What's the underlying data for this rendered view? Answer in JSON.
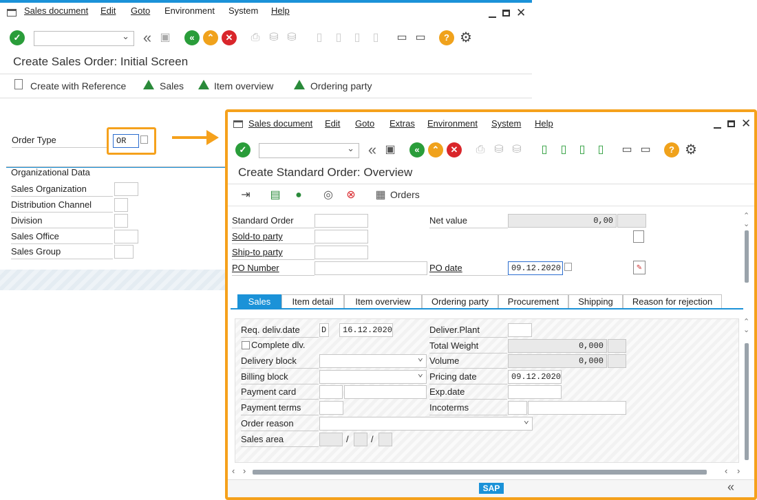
{
  "back_window": {
    "menu": [
      "Sales document",
      "Edit",
      "Goto",
      "Environment",
      "System",
      "Help"
    ],
    "title": "Create Sales Order: Initial Screen",
    "app_toolbar": [
      "Create with Reference",
      "Sales",
      "Item overview",
      "Ordering party"
    ],
    "order_type_label": "Order Type",
    "order_type_value": "OR",
    "org_header": "Organizational Data",
    "org_fields": [
      "Sales Organization",
      "Distribution Channel",
      "Division",
      "Sales Office",
      "Sales Group"
    ]
  },
  "front_window": {
    "menu": [
      "Sales document",
      "Edit",
      "Goto",
      "Extras",
      "Environment",
      "System",
      "Help"
    ],
    "title": "Create Standard Order: Overview",
    "orders_label": "Orders",
    "header": {
      "standard_order": "Standard Order",
      "sold_to": "Sold-to party",
      "ship_to": "Ship-to party",
      "po_number": "PO Number",
      "net_value_label": "Net value",
      "net_value": "0,00",
      "po_date_label": "PO date",
      "po_date": "09.12.2020"
    },
    "tabs": [
      "Sales",
      "Item detail",
      "Item overview",
      "Ordering party",
      "Procurement",
      "Shipping",
      "Reason for rejection"
    ],
    "sales": {
      "req_deliv_label": "Req. deliv.date",
      "req_deliv_type": "D",
      "req_deliv_date": "16.12.2020",
      "complete_dlv": "Complete dlv.",
      "delivery_block": "Delivery block",
      "billing_block": "Billing block",
      "payment_card": "Payment card",
      "payment_terms": "Payment terms",
      "order_reason": "Order reason",
      "sales_area": "Sales area",
      "slash": "/",
      "deliver_plant": "Deliver.Plant",
      "total_weight_label": "Total Weight",
      "total_weight": "0,000",
      "volume_label": "Volume",
      "volume": "0,000",
      "pricing_date_label": "Pricing date",
      "pricing_date": "09.12.2020",
      "exp_date": "Exp.date",
      "incoterms": "Incoterms"
    },
    "footer_logo": "SAP"
  },
  "colors": {
    "accent_orange": "#f5a11c",
    "sap_blue": "#1b92d8",
    "ok_green": "#2a9d3a",
    "cancel_red": "#d9262b"
  }
}
